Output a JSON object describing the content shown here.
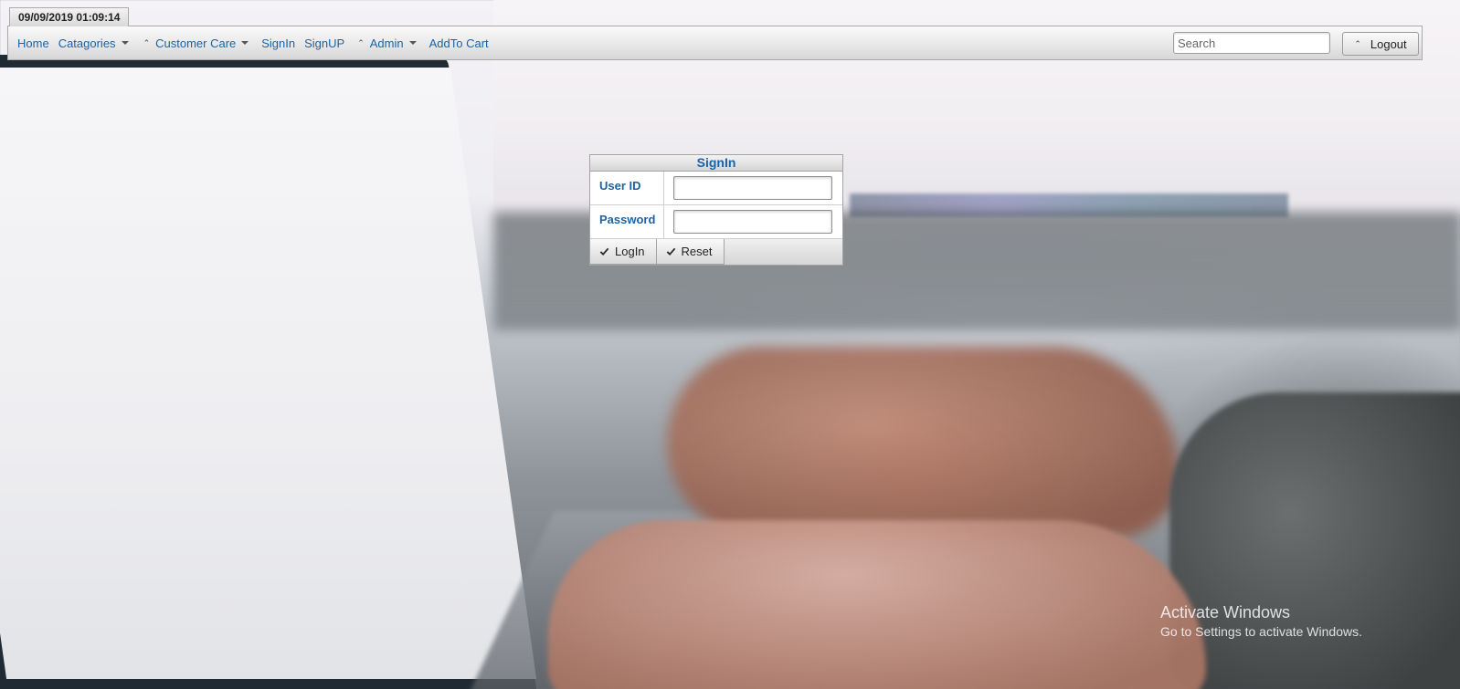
{
  "clock": "09/09/2019 01:09:14",
  "nav": {
    "items": [
      {
        "label": "Home",
        "dropdown": false,
        "chevron": false
      },
      {
        "label": "Catagories",
        "dropdown": true,
        "chevron": false
      },
      {
        "label": "Customer Care",
        "dropdown": true,
        "chevron": true
      },
      {
        "label": "SignIn",
        "dropdown": false,
        "chevron": false
      },
      {
        "label": "SignUP",
        "dropdown": false,
        "chevron": false
      },
      {
        "label": "Admin",
        "dropdown": true,
        "chevron": true
      },
      {
        "label": "AddTo Cart",
        "dropdown": false,
        "chevron": false
      }
    ],
    "search_placeholder": "Search",
    "logout_label": "Logout"
  },
  "signin": {
    "title": "SignIn",
    "user_label": "User ID",
    "password_label": "Password",
    "login_label": "LogIn",
    "reset_label": "Reset"
  },
  "watermark": {
    "title": "Activate Windows",
    "subtitle": "Go to Settings to activate Windows."
  },
  "colors": {
    "link": "#1a63a8",
    "bar_top": "#fafafa",
    "bar_bottom": "#d6d6d6"
  }
}
